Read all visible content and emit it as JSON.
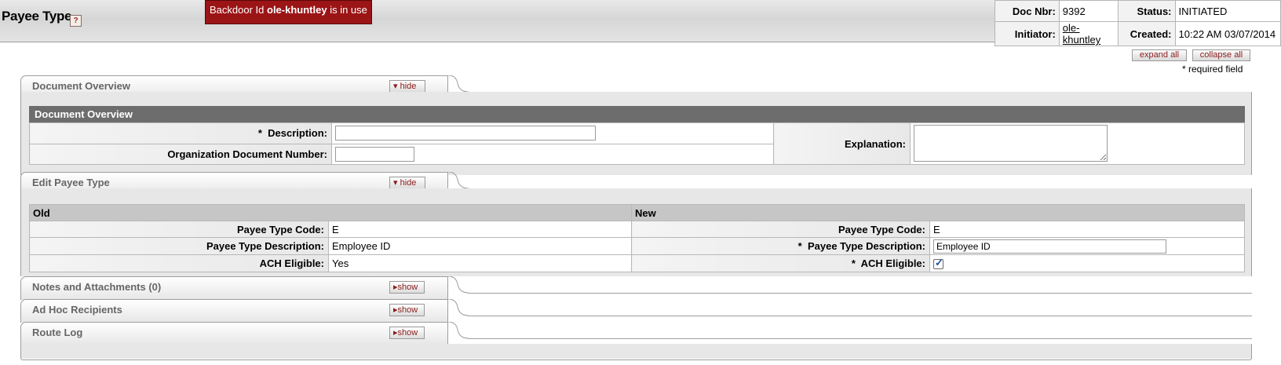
{
  "header": {
    "title": "Payee Type",
    "help_icon": "?",
    "backdoor_prefix": "Backdoor Id ",
    "backdoor_user": "ole-khuntley",
    "backdoor_suffix": " is in use"
  },
  "docinfo": {
    "doc_nbr_label": "Doc Nbr:",
    "doc_nbr": "9392",
    "status_label": "Status:",
    "status": "INITIATED",
    "initiator_label": "Initiator:",
    "initiator": "ole-khuntley",
    "created_label": "Created:",
    "created": "10:22 AM 03/07/2014"
  },
  "controls": {
    "expand_all": "expand all",
    "collapse_all": "collapse all",
    "required_note": "* required field"
  },
  "tabs": {
    "doc_overview": {
      "title": "Document Overview",
      "toggle": "hide"
    },
    "edit_payee": {
      "title": "Edit Payee Type",
      "toggle": "hide"
    },
    "notes": {
      "title": "Notes and Attachments (0)",
      "toggle": "show"
    },
    "adhoc": {
      "title": "Ad Hoc Recipients",
      "toggle": "show"
    },
    "route_log": {
      "title": "Route Log",
      "toggle": "show"
    }
  },
  "doc_overview": {
    "header": "Document Overview",
    "description_label": "Description:",
    "description_value": "",
    "org_doc_label": "Organization Document Number:",
    "org_doc_value": "",
    "explanation_label": "Explanation:",
    "explanation_value": "",
    "required_star": "*"
  },
  "edit": {
    "old_header": "Old",
    "new_header": "New",
    "code_label": "Payee Type Code:",
    "desc_label": "Payee Type Description:",
    "ach_label": "ACH Eligible:",
    "old_code": "E",
    "old_desc": "Employee ID",
    "old_ach": "Yes",
    "new_code": "E",
    "new_desc": "Employee ID",
    "new_ach_checked": true,
    "required_star": "*"
  }
}
